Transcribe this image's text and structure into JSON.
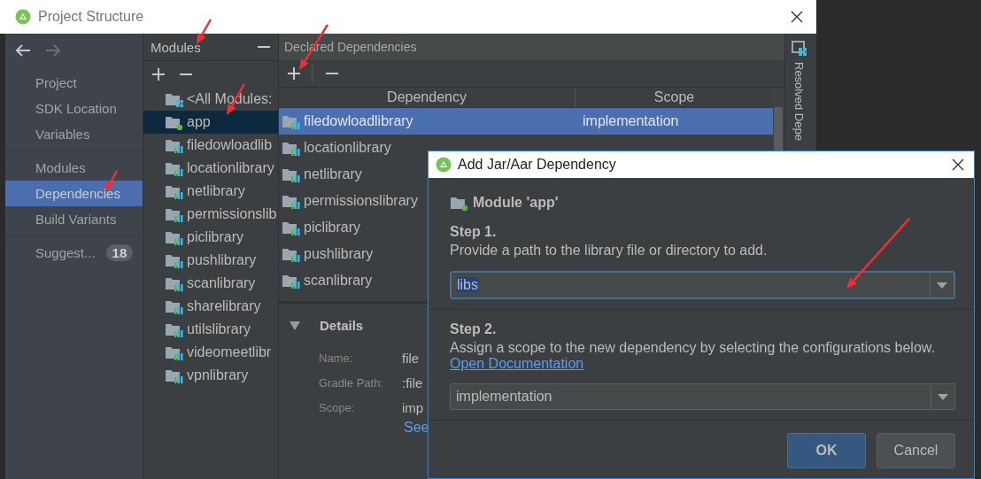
{
  "window": {
    "title": "Project Structure"
  },
  "sidebar": {
    "sections": [
      {
        "items": [
          {
            "label": "Project",
            "selected": false
          },
          {
            "label": "SDK Location",
            "selected": false
          },
          {
            "label": "Variables",
            "selected": false
          }
        ]
      },
      {
        "items": [
          {
            "label": "Modules",
            "selected": false
          },
          {
            "label": "Dependencies",
            "selected": true
          },
          {
            "label": "Build Variants",
            "selected": false
          }
        ]
      },
      {
        "items": [
          {
            "label": "Suggest...",
            "selected": false,
            "badge": "18"
          }
        ]
      }
    ]
  },
  "modules": {
    "title": "Modules",
    "items": [
      {
        "label": "<All Modules:",
        "kind": "all",
        "selected": false
      },
      {
        "label": "app",
        "kind": "app",
        "selected": true
      },
      {
        "label": "filedowloadlib",
        "kind": "library",
        "selected": false
      },
      {
        "label": "locationlibrary",
        "kind": "library",
        "selected": false
      },
      {
        "label": "netlibrary",
        "kind": "library",
        "selected": false
      },
      {
        "label": "permissionslib",
        "kind": "library",
        "selected": false
      },
      {
        "label": "piclibrary",
        "kind": "library",
        "selected": false
      },
      {
        "label": "pushlibrary",
        "kind": "library",
        "selected": false
      },
      {
        "label": "scanlibrary",
        "kind": "library",
        "selected": false
      },
      {
        "label": "sharelibrary",
        "kind": "library",
        "selected": false
      },
      {
        "label": "utilslibrary",
        "kind": "library",
        "selected": false
      },
      {
        "label": "videomeetlibr",
        "kind": "library",
        "selected": false
      },
      {
        "label": "vpnlibrary",
        "kind": "library",
        "selected": false
      }
    ]
  },
  "declared_dependencies": {
    "title": "Declared Dependencies",
    "columns": [
      "Dependency",
      "Scope"
    ],
    "rows": [
      {
        "dependency": "filedowloadlibrary",
        "scope": "implementation",
        "selected": true
      },
      {
        "dependency": "locationlibrary",
        "selected": false
      },
      {
        "dependency": "netlibrary",
        "selected": false
      },
      {
        "dependency": "permissionslibrary",
        "selected": false
      },
      {
        "dependency": "piclibrary",
        "selected": false
      },
      {
        "dependency": "pushlibrary",
        "selected": false
      },
      {
        "dependency": "scanlibrary",
        "selected": false
      }
    ],
    "details": {
      "title": "Details",
      "fields": [
        {
          "label": "Name:",
          "value": "file"
        },
        {
          "label": "Gradle Path:",
          "value": ":file"
        },
        {
          "label": "Scope:",
          "value": "imp"
        }
      ],
      "link": "See"
    }
  },
  "side_tab": {
    "label": "Resolved Depe"
  },
  "dialog": {
    "title": "Add Jar/Aar Dependency",
    "module": "Module 'app'",
    "step1": {
      "title": "Step 1.",
      "text": "Provide a path to the library file or directory to add.",
      "value": "libs",
      "text_selected": true
    },
    "step2": {
      "title": "Step 2.",
      "text": "Assign a scope to the new dependency by selecting the configurations below.",
      "link": "Open Documentation",
      "value": "implementation"
    },
    "buttons": [
      {
        "label": "OK",
        "kind": "default"
      },
      {
        "label": "Cancel",
        "kind": "normal"
      }
    ]
  }
}
